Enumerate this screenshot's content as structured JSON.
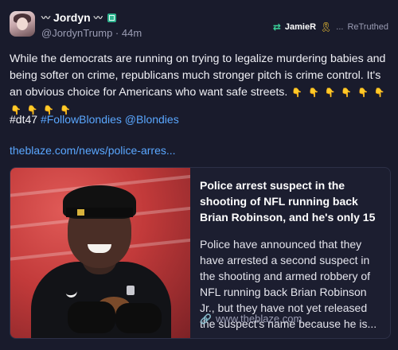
{
  "author": {
    "display_name": "Jordyn",
    "name_decoration": "〰",
    "handle": "@JordynTrump",
    "separator": "·",
    "time_ago": "44m",
    "badge_icon": "verified-square-icon"
  },
  "retruth": {
    "icon": "retruth-arrows-icon",
    "user": "JamieR",
    "ribbon": "🎗",
    "menu": "...",
    "label": "ReTruthed",
    "accent": "#3bd39a"
  },
  "post": {
    "text": "While the democrats are running on trying to legalize murdering babies and being softer on crime, republicans much stronger pitch is crime control. It's an obvious choice for Americans who want safe streets.",
    "emojis": [
      "👇",
      "👇",
      "👇",
      "👇",
      "👇",
      "👇",
      "👇",
      "👇",
      "👇",
      "👇"
    ],
    "plain_tag": "#dt47",
    "tags": [
      "#FollowBlondies",
      "@Blondies"
    ],
    "link": "theblaze.com/news/police-arres..."
  },
  "card": {
    "title": "Police arrest suspect in the shooting of NFL running back Brian Robinson, and he's only 15",
    "description": "Police have announced that they have arrested a second suspect in the shooting and armed robbery of NFL running back Brian Robinson Jr., but they have not yet released the suspect's name because he is...",
    "url": "www.theblaze.com",
    "url_icon": "link-icon"
  },
  "colors": {
    "background": "#191b2c",
    "link": "#5aa7ff",
    "muted": "#9a9cb3"
  }
}
